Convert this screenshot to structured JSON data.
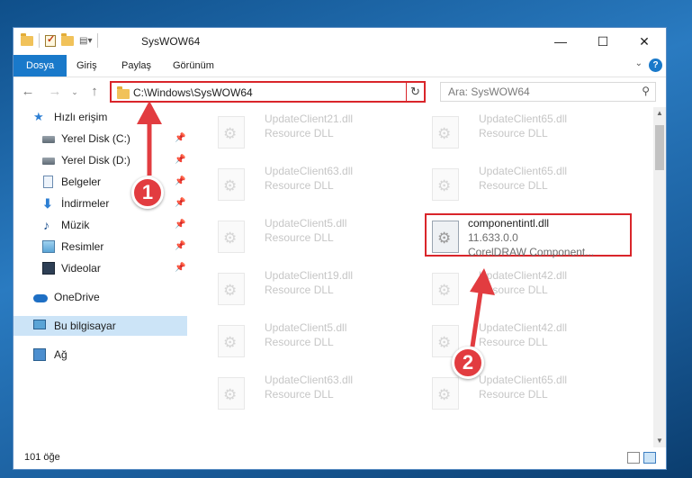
{
  "window": {
    "title": "SysWOW64",
    "minimize": "—",
    "maximize": "☐",
    "close": "✕"
  },
  "ribbon": {
    "tabs": [
      "Dosya",
      "Giriş",
      "Paylaş",
      "Görünüm"
    ],
    "help": "?"
  },
  "address": {
    "path": "C:\\Windows\\SysWOW64",
    "search_placeholder": "Ara: SysWOW64"
  },
  "sidebar": {
    "items": [
      {
        "label": "Hızlı erişim",
        "icon": "star-icon",
        "pinned": false
      },
      {
        "label": "Yerel Disk (C:)",
        "icon": "disk-icon",
        "pinned": true
      },
      {
        "label": "Yerel Disk (D:)",
        "icon": "disk-icon",
        "pinned": true
      },
      {
        "label": "Belgeler",
        "icon": "document-icon",
        "pinned": true
      },
      {
        "label": "İndirmeler",
        "icon": "download-icon",
        "pinned": true
      },
      {
        "label": "Müzik",
        "icon": "music-icon",
        "pinned": true
      },
      {
        "label": "Resimler",
        "icon": "pictures-icon",
        "pinned": true
      },
      {
        "label": "Videolar",
        "icon": "videos-icon",
        "pinned": true
      },
      {
        "label": "OneDrive",
        "icon": "onedrive-icon",
        "pinned": false
      },
      {
        "label": "Bu bilgisayar",
        "icon": "computer-icon",
        "pinned": false,
        "selected": true
      },
      {
        "label": "Ağ",
        "icon": "network-icon",
        "pinned": false
      }
    ]
  },
  "files": {
    "left": [
      {
        "name": "UpdateClient21.dll",
        "desc": "Resource DLL"
      },
      {
        "name": "UpdateClient63.dll",
        "desc": "Resource DLL"
      },
      {
        "name": "UpdateClient5.dll",
        "desc": "Resource DLL"
      },
      {
        "name": "UpdateClient19.dll",
        "desc": "Resource DLL"
      },
      {
        "name": "UpdateClient5.dll",
        "desc": "Resource DLL"
      },
      {
        "name": "UpdateClient63.dll",
        "desc": "Resource DLL"
      }
    ],
    "right": [
      {
        "name": "UpdateClient65.dll",
        "desc": "Resource DLL"
      },
      {
        "name": "UpdateClient65.dll",
        "desc": "Resource DLL"
      },
      {
        "name": "UpdateClient42.dll",
        "desc": "Resource DLL"
      },
      {
        "name": "UpdateClient42.dll",
        "desc": "Resource DLL"
      },
      {
        "name": "UpdateClient65.dll",
        "desc": "Resource DLL"
      }
    ],
    "highlighted": {
      "name": "componentintl.dll",
      "version": "11.633.0.0",
      "desc": "CorelDRAW Component..."
    }
  },
  "status": {
    "count": "101 öğe"
  },
  "callouts": [
    "1",
    "2"
  ],
  "colors": {
    "accent": "#1979ca",
    "highlight_border": "#d9252a",
    "callout": "#e23c40",
    "selected_bg": "#cce4f7"
  }
}
